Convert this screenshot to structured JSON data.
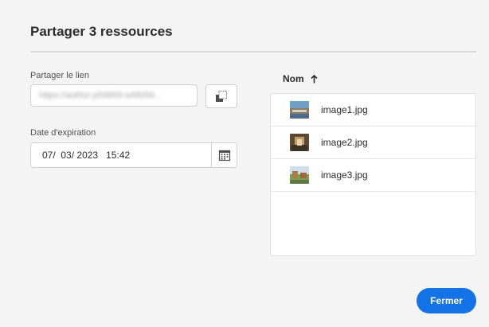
{
  "dialog": {
    "title": "Partager 3 ressources"
  },
  "share_link": {
    "label": "Partager le lien",
    "value": "https://author-p54859-e49056..."
  },
  "expiration": {
    "label": "Date d'expiration",
    "day": "07",
    "month": "03",
    "year": "2023",
    "hour": "15",
    "minute": "42"
  },
  "list": {
    "column_header": "Nom",
    "items": [
      {
        "name": "image1.jpg"
      },
      {
        "name": "image2.jpg"
      },
      {
        "name": "image3.jpg"
      }
    ]
  },
  "footer": {
    "close_label": "Fermer"
  },
  "colors": {
    "accent": "#1473e6",
    "background": "#f4f4f4"
  }
}
